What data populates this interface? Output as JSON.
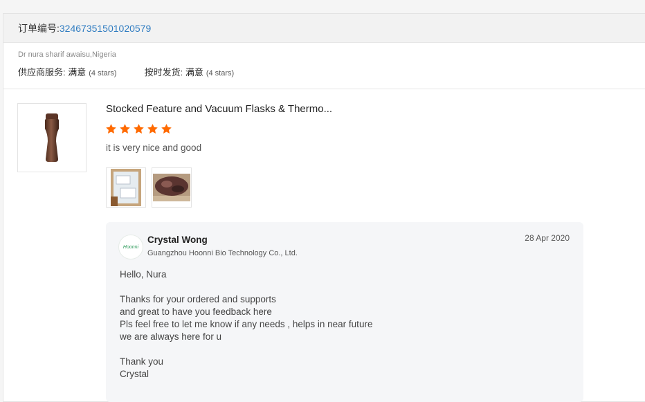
{
  "order": {
    "label": "订单编号: ",
    "number": "32467351501020579"
  },
  "buyer": {
    "name": "Dr nura sharif awaisu,Nigeria"
  },
  "ratings": [
    {
      "label": "供应商服务: ",
      "value": "满意",
      "stars": "(4 stars)"
    },
    {
      "label": "按时发货: ",
      "value": "满意",
      "stars": "(4 stars)"
    }
  ],
  "review": {
    "product_title": "Stocked Feature and Vacuum Flasks & Thermo...",
    "star_count": 5,
    "star_color": "#ff6a00",
    "text": "it is very nice and good"
  },
  "reply": {
    "name": "Crystal Wong",
    "company": "Guangzhou Hoonni Bio Technology Co., Ltd.",
    "date": "28 Apr 2020",
    "avatar_text": "Hoonni",
    "body": "Hello, Nura\n\nThanks for your ordered and supports\nand great to have you feedback here\nPls feel free to let me know if any needs , helps in near future\n we are always here for u\n\nThank you\nCrystal"
  },
  "colors": {
    "link": "#2f7cc1",
    "accent": "#ff6a00"
  }
}
